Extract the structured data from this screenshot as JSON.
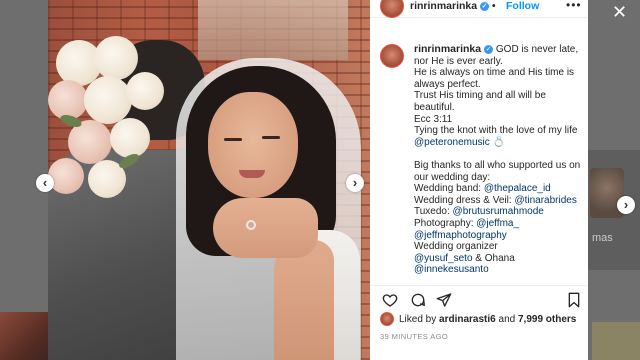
{
  "post": {
    "username": "rinrinmarinka",
    "follow_label": "Follow",
    "dot_separator": "•",
    "more_label": "•••",
    "caption_lines": [
      {
        "text": "GOD is never late,",
        "mention": false
      },
      {
        "text": "nor He is ever early.",
        "mention": false
      },
      {
        "text": "He is always on time and His time is",
        "mention": false
      },
      {
        "text": "always perfect.",
        "mention": false
      },
      {
        "text": "Trust His timing and all will be",
        "mention": false
      },
      {
        "text": "beautiful.",
        "mention": false
      },
      {
        "text": "Ecc 3:11",
        "mention": false
      },
      {
        "text": "Tying the knot with the love of my life",
        "mention": false
      },
      {
        "text": "@peteronemusic 💍",
        "mention": true
      },
      {
        "text": "",
        "mention": false
      },
      {
        "text": "Big thanks to all who supported us on",
        "mention": false
      },
      {
        "text": "our wedding day:",
        "mention": false
      }
    ],
    "credits": [
      {
        "label": "Wedding band: ",
        "handle": "@thepalace_id"
      },
      {
        "label": "Wedding dress & Veil: ",
        "handle": "@tinarabrides"
      },
      {
        "label": "Tuxedo: ",
        "handle": "@brutusrumahmode"
      },
      {
        "label": "Photography: ",
        "handle": "@jeffma_"
      },
      {
        "label": "",
        "handle": "@jeffmaphotography"
      },
      {
        "label": "Wedding organizer",
        "handle": ""
      },
      {
        "label": "",
        "handle": "@yusuf_seto"
      },
      {
        "label": "",
        "handle": "@innekesusanto"
      }
    ],
    "credit_suffix_ohana": " & Ohana",
    "likes_prefix": "Liked by ",
    "likes_user": "ardinarasti6",
    "likes_mid": " and ",
    "likes_count": "7,999 others",
    "timestamp": "39 MINUTES AGO"
  },
  "background": {
    "right_partial_text": "mas"
  },
  "icons": {
    "close": "close-icon",
    "prev": "chevron-left-icon",
    "next": "chevron-right-icon",
    "like": "heart-icon",
    "comment": "comment-icon",
    "share": "share-icon",
    "save": "bookmark-icon",
    "verified": "verified-badge-icon"
  },
  "colors": {
    "link_blue": "#0095f6",
    "mention": "#00376b",
    "verified": "#3897f0",
    "text": "#262626",
    "muted": "#8e8e8e"
  }
}
